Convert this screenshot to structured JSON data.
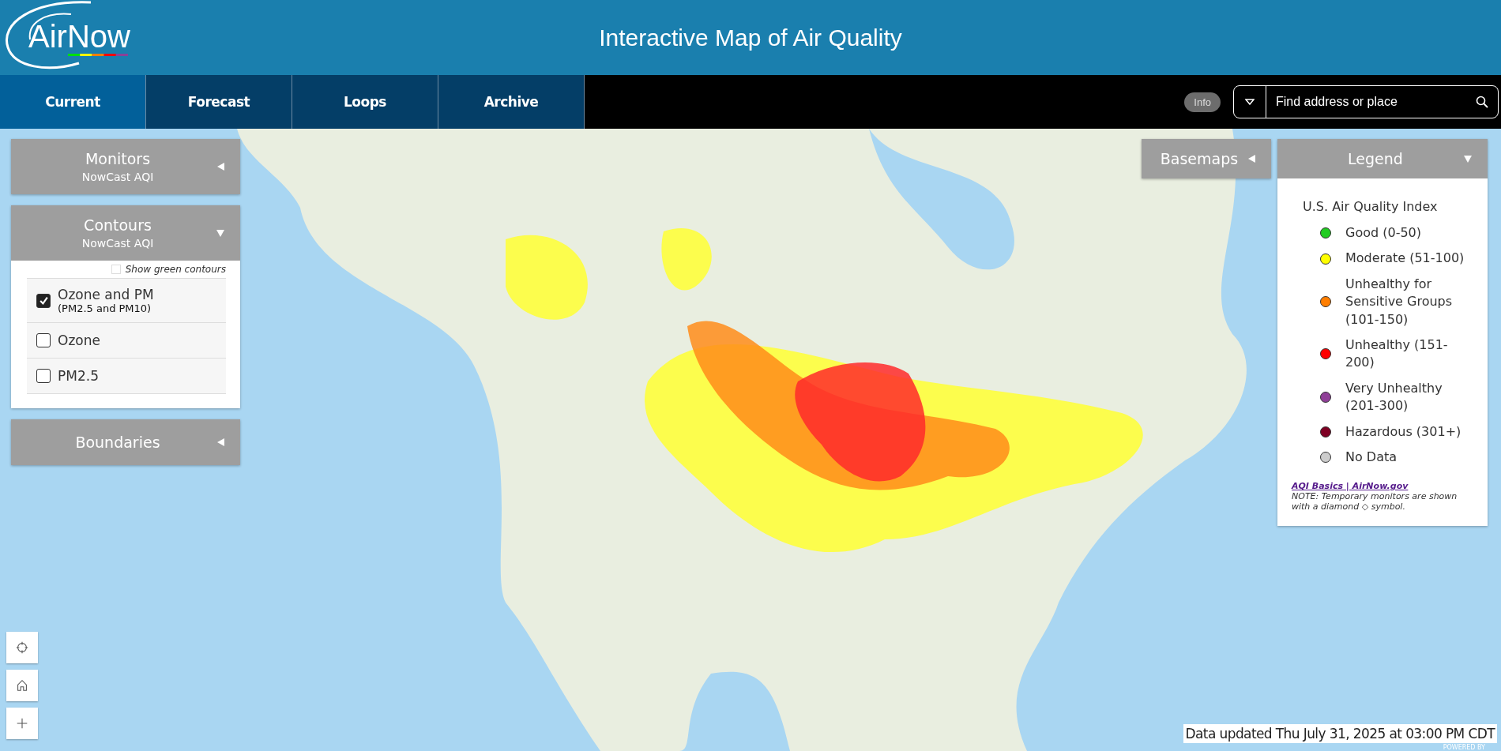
{
  "header": {
    "logo": "AirNow",
    "title": "Interactive Map of Air Quality"
  },
  "tabs": [
    {
      "label": "Current",
      "selected": true
    },
    {
      "label": "Forecast",
      "selected": false
    },
    {
      "label": "Loops",
      "selected": false
    },
    {
      "label": "Archive",
      "selected": false
    }
  ],
  "info_button": "Info",
  "search": {
    "placeholder": "Find address or place"
  },
  "panels": [
    {
      "title": "Monitors",
      "subtitle": "NowCast AQI",
      "expanded": false
    },
    {
      "title": "Contours",
      "subtitle": "NowCast AQI",
      "expanded": true,
      "green_contours": {
        "label": "Show green contours",
        "checked": false
      },
      "options": [
        {
          "label": "Ozone and PM",
          "note": "(PM2.5 and PM10)",
          "checked": true
        },
        {
          "label": "Ozone",
          "checked": false
        },
        {
          "label": "PM2.5",
          "checked": false
        }
      ]
    },
    {
      "title": "Boundaries",
      "expanded": false
    }
  ],
  "basemaps": {
    "title": "Basemaps",
    "expanded": false
  },
  "legend": {
    "title": "Legend",
    "expanded": true,
    "heading": "U.S. Air Quality Index",
    "items": [
      {
        "label": "Good (0-50)",
        "color": "#22cc22"
      },
      {
        "label": "Moderate (51-100)",
        "color": "#ffff00"
      },
      {
        "label": "Unhealthy for Sensitive Groups (101-150)",
        "color": "#ff7e00"
      },
      {
        "label": "Unhealthy (151-200)",
        "color": "#ff0000"
      },
      {
        "label": "Very Unhealthy (201-300)",
        "color": "#8f3f97"
      },
      {
        "label": "Hazardous (301+)",
        "color": "#7e0023"
      },
      {
        "label": "No Data",
        "color": "#cccccc"
      }
    ],
    "link": "AQI Basics | AirNow.gov",
    "note": "NOTE: Temporary monitors are shown with a diamond ◇ symbol."
  },
  "status": "Data updated Thu July 31, 2025 at 03:00 PM CDT",
  "attribution": "POWERED BY"
}
